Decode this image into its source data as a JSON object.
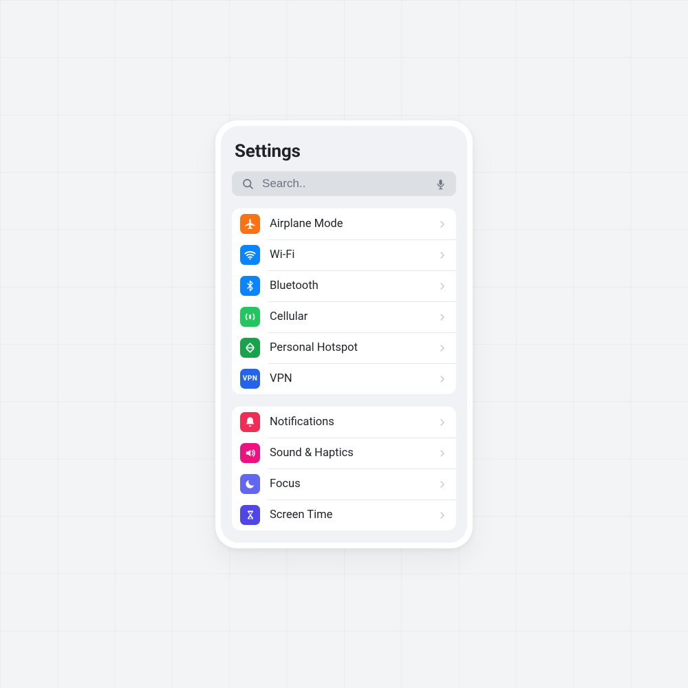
{
  "title": "Settings",
  "search": {
    "placeholder": "Search.."
  },
  "groups": [
    {
      "items": [
        {
          "id": "airplane",
          "label": "Airplane Mode",
          "icon": "airplane-icon",
          "color": "c-orange"
        },
        {
          "id": "wifi",
          "label": "Wi-Fi",
          "icon": "wifi-icon",
          "color": "c-blue"
        },
        {
          "id": "bt",
          "label": "Bluetooth",
          "icon": "bluetooth-icon",
          "color": "c-blue"
        },
        {
          "id": "cell",
          "label": "Cellular",
          "icon": "cellular-icon",
          "color": "c-green"
        },
        {
          "id": "hotspot",
          "label": "Personal Hotspot",
          "icon": "personal-hotspot-icon",
          "color": "c-greenD"
        },
        {
          "id": "vpn",
          "label": "VPN",
          "icon": "vpn-icon",
          "color": "c-blueD"
        }
      ]
    },
    {
      "items": [
        {
          "id": "notif",
          "label": "Notifications",
          "icon": "bell-icon",
          "color": "c-red"
        },
        {
          "id": "sound",
          "label": "Sound & Haptics",
          "icon": "speaker-icon",
          "color": "c-pink"
        },
        {
          "id": "focus",
          "label": "Focus",
          "icon": "moon-icon",
          "color": "c-indigo"
        },
        {
          "id": "screen",
          "label": "Screen Time",
          "icon": "hourglass-icon",
          "color": "c-indigoD"
        }
      ]
    }
  ]
}
